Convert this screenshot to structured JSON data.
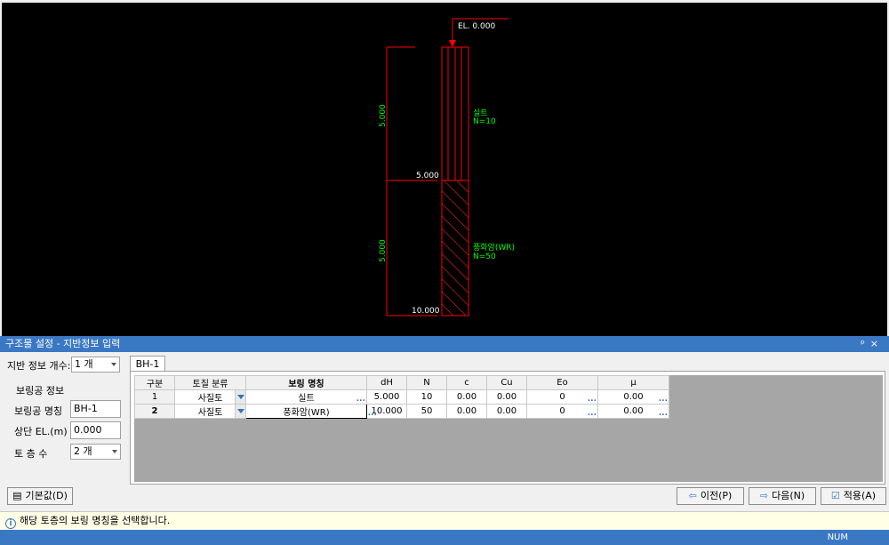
{
  "cad": {
    "el_top": "EL. 0.000",
    "layers": [
      {
        "name": "실트",
        "n": "N=10",
        "thickness": "5.000",
        "depth": "5.000"
      },
      {
        "name": "풍화암(WR)",
        "n": "N=50",
        "thickness": "5.000",
        "depth": "10.000"
      }
    ],
    "colors": {
      "dim": "#ff0000",
      "hatch": "#ff2020",
      "text": "#00ff00",
      "bg": "#000000"
    }
  },
  "panel": {
    "title": "구조물 설정 - 지반정보 입력",
    "controls": "ᵖ ×",
    "layer_count_label": "지반 정보 개수:",
    "layer_count_value": "1 개",
    "boring_section_label": "보링공 정보",
    "boring_name_label": "보링공 명칭",
    "boring_name_value": "BH-1",
    "top_el_label": "상단 EL.(m)",
    "top_el_value": "0.000",
    "soil_layers_label": "토  층  수",
    "soil_layers_value": "2 개",
    "tab": "BH-1"
  },
  "grid": {
    "headers": [
      "구분",
      "토질 분류",
      "보링 명칭",
      "dH",
      "N",
      "c",
      "Cu",
      "Eo",
      "μ"
    ],
    "rows": [
      {
        "no": "1",
        "soil": "사질토",
        "name": "실트",
        "dH": "5.000",
        "N": "10",
        "c": "0.00",
        "Cu": "0.00",
        "Eo": "0",
        "mu": "0.00"
      },
      {
        "no": "2",
        "soil": "사질토",
        "name": "풍화암(WR)",
        "dH": "10.000",
        "N": "50",
        "c": "0.00",
        "Cu": "0.00",
        "Eo": "0",
        "mu": "0.00"
      }
    ]
  },
  "buttons": {
    "default": "기본값(D)",
    "prev": "이전(P)",
    "next": "다음(N)",
    "apply": "적용(A)"
  },
  "status": {
    "message": "해당 토층의 보링 명칭을 선택합니다.",
    "indicator": "NUM"
  }
}
